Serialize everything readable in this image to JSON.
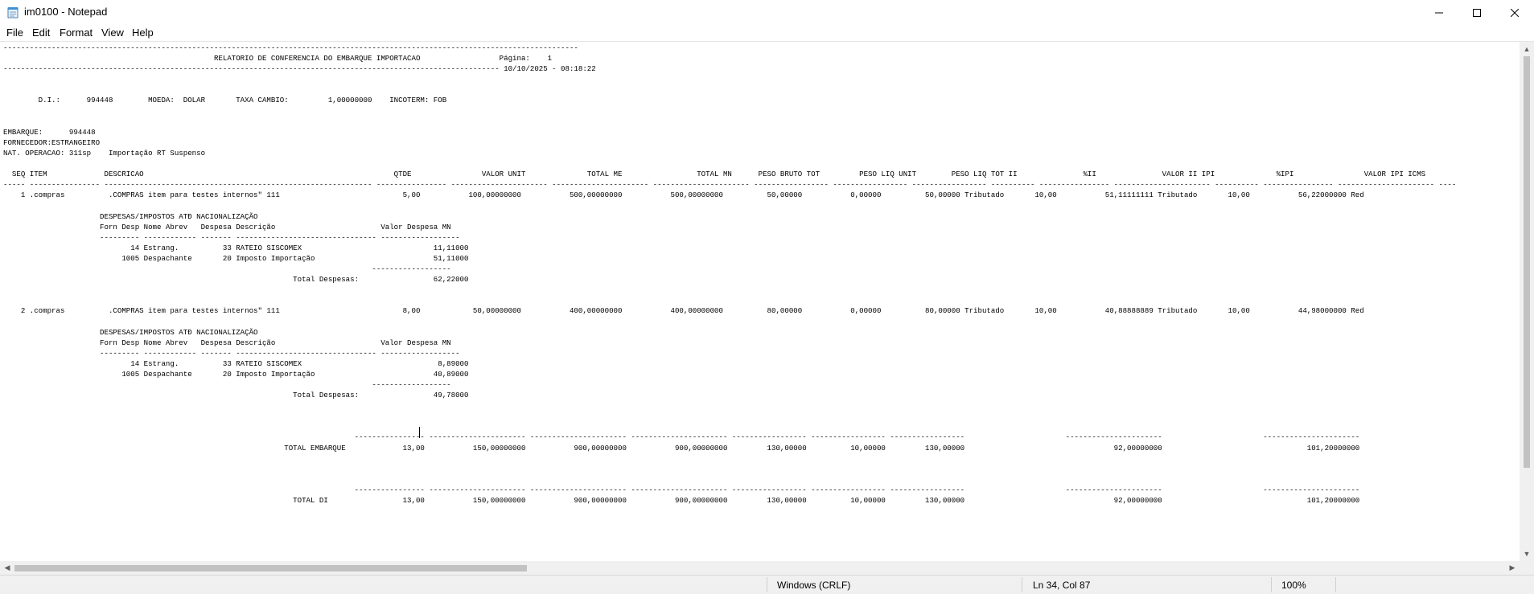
{
  "window": {
    "title": "im0100 - Notepad",
    "icon": "notepad-icon",
    "controls": {
      "minimize": "minimize-icon",
      "maximize": "maximize-icon",
      "close": "close-icon"
    }
  },
  "menu": {
    "file": "File",
    "edit": "Edit",
    "format": "Format",
    "view": "View",
    "help": "Help"
  },
  "document": {
    "lines": [
      "-----------------------------------------------------------------------------------------------------------------------------------",
      "                                                RELATORIO DE CONFERENCIA DO EMBARQUE IMPORTACAO                  Página:    1",
      "----------------------------------------------------------------------------------------------------------------- 10/10/2025 - 08:18:22",
      "",
      "",
      "        D.I.:      994448        MOEDA:  DOLAR       TAXA CAMBIO:         1,00000000    INCOTERM: FOB",
      "",
      "",
      "EMBARQUE:      994448",
      "FORNECEDOR:ESTRANGEIRO",
      "NAT. OPERACAO: 311sp    Importação RT Suspenso",
      "",
      "  SEQ ITEM             DESCRICAO                                                         QTDE                VALOR UNIT              TOTAL ME                 TOTAL MN      PESO BRUTO TOT         PESO LIQ UNIT        PESO LIQ TOT II               %II               VALOR II IPI              %IPI                VALOR IPI ICMS",
      "----- ---------------- ------------------------------------------------------------- ---------------- ---------------------- ---------------------- ---------------------- ----------------- ----------------- ----------------- ---------- ---------------- ---------------------- ---------- ---------------- ---------------------- ----",
      "    1 .compras          .COMPRAS item para testes internos\" 111                            5,00           100,00000000           500,00000000           500,00000000          50,00000           0,00000          50,00000 Tributado       10,00           51,11111111 Tributado       10,00           56,22000000 Red",
      "",
      "                      DESPESAS/IMPOSTOS ATÐ NACIONALIZAÇÃO",
      "                      Forn Desp Nome Abrev   Despesa Descrição                        Valor Despesa MN",
      "                      --------- ------------ ------- -------------------------------- ------------------",
      "                             14 Estrang.          33 RATEIO SISCOMEX                              11,11000",
      "                           1005 Despachante       20 Imposto Importação                           51,11000",
      "                                                                                    ------------------",
      "                                                                  Total Despesas:                 62,22000",
      "",
      "",
      "    2 .compras          .COMPRAS item para testes internos\" 111                            8,00            50,00000000           400,00000000           400,00000000          80,00000           0,00000          80,00000 Tributado       10,00           40,88888889 Tributado       10,00           44,98000000 Red",
      "",
      "                      DESPESAS/IMPOSTOS ATÐ NACIONALIZAÇÃO",
      "                      Forn Desp Nome Abrev   Despesa Descrição                        Valor Despesa MN",
      "                      --------- ------------ ------- -------------------------------- ------------------",
      "                             14 Estrang.          33 RATEIO SISCOMEX                               8,89000",
      "                           1005 Despachante       20 Imposto Importação                           40,89000",
      "                                                                                    ------------------",
      "                                                                  Total Despesas:                 49,78000",
      "",
      "",
      "",
      "                                                                                ---------------- ---------------------- ---------------------- ---------------------- ----------------- ----------------- -----------------                       ----------------------                       ----------------------",
      "                                                                TOTAL EMBARQUE             13,00           150,00000000           900,00000000           900,00000000         130,00000          10,00000         130,00000                                  92,00000000                                 101,20000000",
      "",
      "",
      "",
      "                                                                                ---------------- ---------------------- ---------------------- ---------------------- ----------------- ----------------- -----------------                       ----------------------                       ----------------------",
      "                                                                  TOTAL DI                 13,00           150,00000000           900,00000000           900,00000000         130,00000          10,00000         130,00000                                  92,00000000                                 101,20000000"
    ]
  },
  "status": {
    "line_ending": "Windows (CRLF)",
    "position": "Ln 34, Col 87",
    "zoom": "100%"
  }
}
